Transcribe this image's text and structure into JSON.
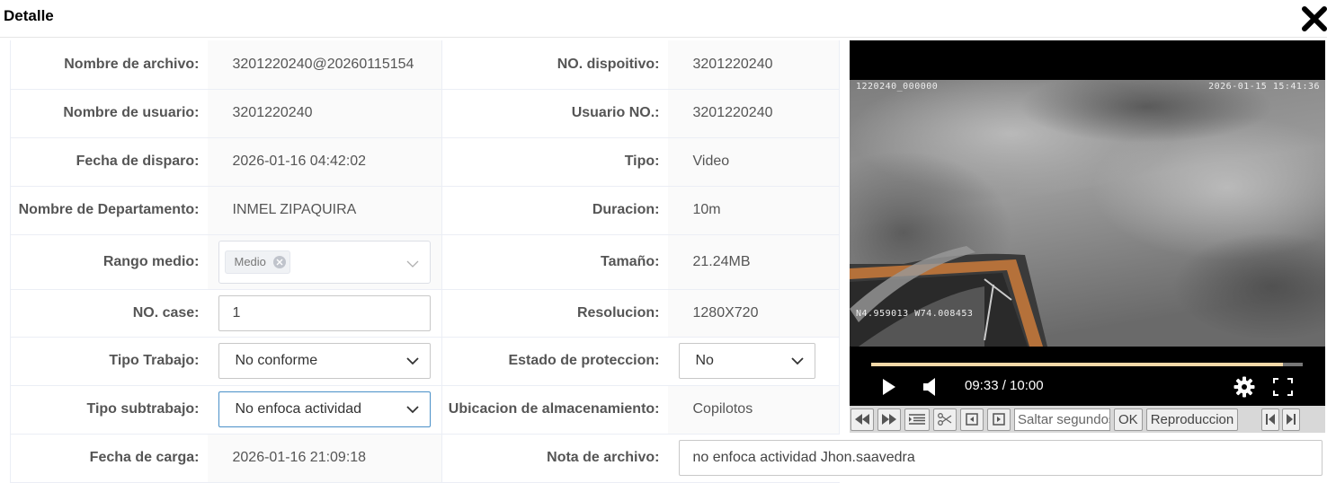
{
  "header": {
    "title": "Detalle"
  },
  "rows": [
    {
      "l1": "Nombre de archivo:",
      "v1": "3201220240@20260115154",
      "l2": "NO. dispoitivo:",
      "v2": "3201220240"
    },
    {
      "l1": "Nombre de usuario:",
      "v1": "3201220240",
      "l2": "Usuario NO.:",
      "v2": "3201220240"
    },
    {
      "l1": "Fecha de disparo:",
      "v1": "2026-01-16 04:42:02",
      "l2": "Tipo:",
      "v2": "Video"
    },
    {
      "l1": "Nombre de Departamento:",
      "v1": "INMEL ZIPAQUIRA",
      "l2": "Duracion:",
      "v2": "10m"
    },
    {
      "l1": "Rango medio:",
      "tag": "Medio",
      "l2": "Tamaño:",
      "v2": "21.24MB"
    },
    {
      "l1": "NO. case:",
      "input": "1",
      "l2": "Resolucion:",
      "v2": "1280X720"
    },
    {
      "l1": "Tipo Trabajo:",
      "select": "No conforme",
      "l2": "Estado de proteccion:",
      "select2": "No"
    },
    {
      "l1": "Tipo subtrabajo:",
      "select": "No enfoca actividad",
      "l2": "Ubicacion de almacenamiento:",
      "v2": "Copilotos"
    },
    {
      "l1": "Fecha de carga:",
      "v1": "2026-01-16 21:09:18",
      "l2": "Nota de archivo:",
      "note": "no enfoca actividad Jhon.saavedra"
    }
  ],
  "video": {
    "osd_left": "1220240_000000",
    "osd_right": "2026-01-15  15:41:36",
    "osd_gps": "N4.959013  W74.008453",
    "time": "09:33 / 10:00",
    "progress": 0.955
  },
  "toolbar": {
    "seek_placeholder": "Saltar segundos",
    "ok_label": "OK",
    "playback_label": "Reproduccion"
  },
  "icons": {
    "close": "close-icon",
    "play": "play-icon",
    "volume": "volume-icon",
    "settings": "gear-icon",
    "fullscreen": "fullscreen-icon"
  },
  "colors": {
    "video_bg": "#000000",
    "progress": "#f5d9a8",
    "focus_border": "#4a90c8"
  }
}
